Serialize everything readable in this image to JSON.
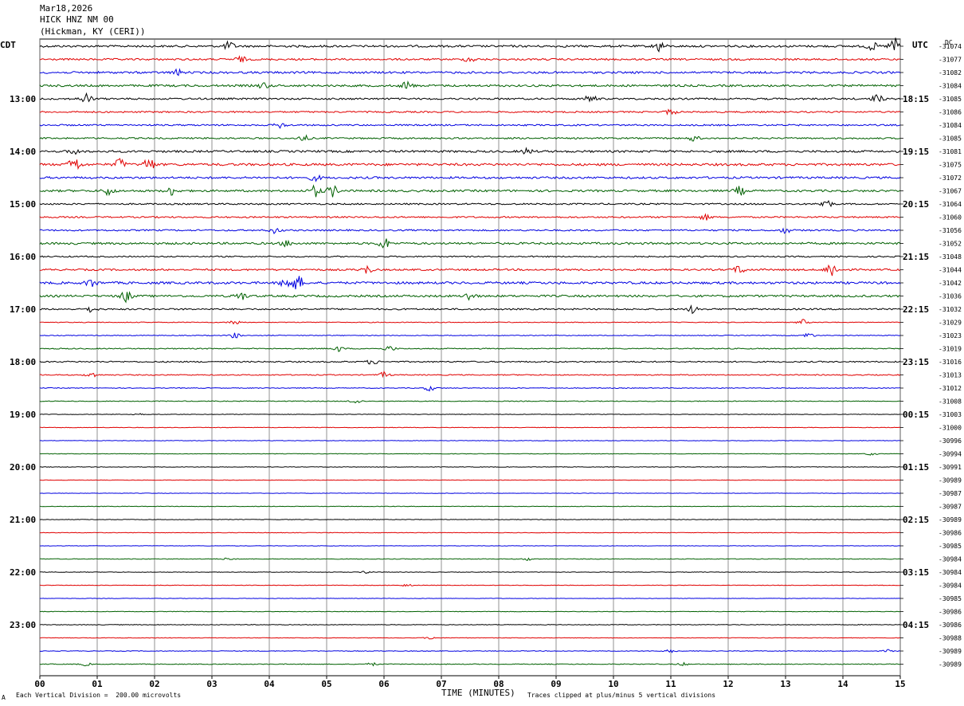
{
  "header": {
    "date": "Mar18,2026",
    "station": "HICK HNZ NM 00",
    "location": "(Hickman, KY (CERI))"
  },
  "left_timezone": "CDT",
  "right_timezone": "UTC",
  "right_corner_label": "DC",
  "footer": {
    "scale_note": "Each Vertical Division =  200.00 microvolts",
    "clip_note": "Traces clipped at plus/minus 5 vertical divisions",
    "corner_mark": "A"
  },
  "trace_colors": [
    "#000000",
    "#e00000",
    "#0000e0",
    "#006000"
  ],
  "chart_data": {
    "type": "line",
    "title": "HICK HNZ NM 00",
    "xlabel": "TIME (MINUTES)",
    "ylabel": "",
    "x_range": [
      0,
      15
    ],
    "x_ticks": [
      "00",
      "01",
      "02",
      "03",
      "04",
      "05",
      "06",
      "07",
      "08",
      "09",
      "10",
      "11",
      "12",
      "13",
      "14",
      "15"
    ],
    "traces_per_hour": 4,
    "minutes_per_trace": 15,
    "left_hour_labels": [
      "13:00",
      "14:00",
      "15:00",
      "16:00",
      "17:00",
      "18:00",
      "19:00",
      "20:00",
      "21:00",
      "22:00",
      "23:00"
    ],
    "right_hour_labels": [
      "18:15",
      "19:15",
      "20:15",
      "21:15",
      "22:15",
      "23:15",
      "00:15",
      "01:15",
      "02:15",
      "03:15",
      "04:15"
    ],
    "dc_offsets": [
      "-31074",
      "-31077",
      "-31082",
      "-31084",
      "-31085",
      "-31086",
      "-31084",
      "-31085",
      "-31081",
      "-31075",
      "-31072",
      "-31067",
      "-31064",
      "-31060",
      "-31056",
      "-31052",
      "-31048",
      "-31044",
      "-31042",
      "-31036",
      "-31032",
      "-31029",
      "-31023",
      "-31019",
      "-31016",
      "-31013",
      "-31012",
      "-31008",
      "-31003",
      "-31000",
      "-30996",
      "-30994",
      "-30991",
      "-30989",
      "-30987",
      "-30987",
      "-30989",
      "-30986",
      "-30985",
      "-30984",
      "-30984",
      "-30984",
      "-30985",
      "-30986",
      "-30986",
      "-30988",
      "-30989",
      "-30989"
    ],
    "trace_activity": [
      {
        "noise": 0.8,
        "events": [
          [
            3.3,
            3
          ],
          [
            10.8,
            4
          ],
          [
            14.5,
            3
          ],
          [
            14.9,
            6
          ]
        ]
      },
      {
        "noise": 0.7,
        "events": [
          [
            3.5,
            2
          ],
          [
            7.5,
            2
          ]
        ]
      },
      {
        "noise": 0.8,
        "events": [
          [
            2.4,
            2
          ]
        ]
      },
      {
        "noise": 0.8,
        "events": [
          [
            3.9,
            2
          ],
          [
            6.4,
            3
          ]
        ]
      },
      {
        "noise": 0.7,
        "events": [
          [
            0.8,
            4
          ],
          [
            9.6,
            3
          ],
          [
            14.6,
            3
          ]
        ]
      },
      {
        "noise": 0.6,
        "events": [
          [
            11,
            2
          ]
        ]
      },
      {
        "noise": 0.6,
        "events": [
          [
            4.2,
            2
          ]
        ]
      },
      {
        "noise": 0.6,
        "events": [
          [
            4.6,
            2
          ],
          [
            11.4,
            2
          ]
        ]
      },
      {
        "noise": 0.8,
        "events": [
          [
            0.6,
            2
          ],
          [
            8.5,
            2
          ]
        ]
      },
      {
        "noise": 0.9,
        "events": [
          [
            0.6,
            6
          ],
          [
            1.4,
            4
          ],
          [
            1.9,
            5
          ]
        ]
      },
      {
        "noise": 0.8,
        "events": [
          [
            4.8,
            2
          ]
        ]
      },
      {
        "noise": 0.8,
        "events": [
          [
            1.2,
            3
          ],
          [
            2.3,
            3
          ],
          [
            4.8,
            4
          ],
          [
            5.1,
            4
          ],
          [
            12.2,
            3
          ]
        ]
      },
      {
        "noise": 0.6,
        "events": [
          [
            13.7,
            4
          ]
        ]
      },
      {
        "noise": 0.6,
        "events": [
          [
            11.6,
            2
          ]
        ]
      },
      {
        "noise": 0.6,
        "events": [
          [
            4.1,
            2
          ],
          [
            13,
            2
          ]
        ]
      },
      {
        "noise": 0.8,
        "events": [
          [
            4.3,
            2
          ],
          [
            6,
            4
          ]
        ]
      },
      {
        "noise": 0.5,
        "events": []
      },
      {
        "noise": 0.7,
        "events": [
          [
            5.7,
            3
          ],
          [
            12.2,
            3
          ],
          [
            13.8,
            6
          ]
        ]
      },
      {
        "noise": 0.9,
        "events": [
          [
            0.9,
            3
          ],
          [
            4.3,
            5
          ],
          [
            4.5,
            5
          ]
        ]
      },
      {
        "noise": 0.8,
        "events": [
          [
            1.5,
            4
          ],
          [
            3.5,
            3
          ],
          [
            7.5,
            3
          ]
        ]
      },
      {
        "noise": 0.6,
        "events": [
          [
            0.9,
            2
          ],
          [
            11.4,
            3
          ]
        ]
      },
      {
        "noise": 0.3,
        "events": [
          [
            3.4,
            2
          ],
          [
            13.3,
            2
          ]
        ]
      },
      {
        "noise": 0.3,
        "events": [
          [
            3.4,
            2
          ],
          [
            13.4,
            2
          ]
        ]
      },
      {
        "noise": 0.4,
        "events": [
          [
            5.2,
            2
          ],
          [
            6.1,
            2
          ]
        ]
      },
      {
        "noise": 0.5,
        "events": [
          [
            5.8,
            2
          ]
        ]
      },
      {
        "noise": 0.4,
        "events": [
          [
            6,
            2
          ],
          [
            0.9,
            2
          ]
        ]
      },
      {
        "noise": 0.3,
        "events": [
          [
            6.8,
            2
          ]
        ]
      },
      {
        "noise": 0.3,
        "events": [
          [
            5.5,
            2
          ]
        ]
      },
      {
        "noise": 0.2,
        "events": [
          [
            1.7,
            1
          ]
        ]
      },
      {
        "noise": 0.2,
        "events": []
      },
      {
        "noise": 0.2,
        "events": []
      },
      {
        "noise": 0.2,
        "events": [
          [
            14.5,
            1
          ]
        ]
      },
      {
        "noise": 0.2,
        "events": []
      },
      {
        "noise": 0.15,
        "events": []
      },
      {
        "noise": 0.15,
        "events": []
      },
      {
        "noise": 0.2,
        "events": []
      },
      {
        "noise": 0.2,
        "events": []
      },
      {
        "noise": 0.2,
        "events": []
      },
      {
        "noise": 0.15,
        "events": []
      },
      {
        "noise": 0.25,
        "events": [
          [
            3.3,
            1
          ],
          [
            8.5,
            1
          ]
        ]
      },
      {
        "noise": 0.2,
        "events": [
          [
            5.7,
            1
          ]
        ]
      },
      {
        "noise": 0.2,
        "events": [
          [
            6.4,
            1
          ]
        ]
      },
      {
        "noise": 0.15,
        "events": []
      },
      {
        "noise": 0.2,
        "events": []
      },
      {
        "noise": 0.25,
        "events": []
      },
      {
        "noise": 0.2,
        "events": [
          [
            6.8,
            1
          ]
        ]
      },
      {
        "noise": 0.25,
        "events": [
          [
            11,
            1
          ],
          [
            14.8,
            1
          ]
        ]
      },
      {
        "noise": 0.3,
        "events": [
          [
            0.8,
            1
          ],
          [
            5.8,
            1
          ],
          [
            11.2,
            1
          ]
        ]
      }
    ]
  }
}
